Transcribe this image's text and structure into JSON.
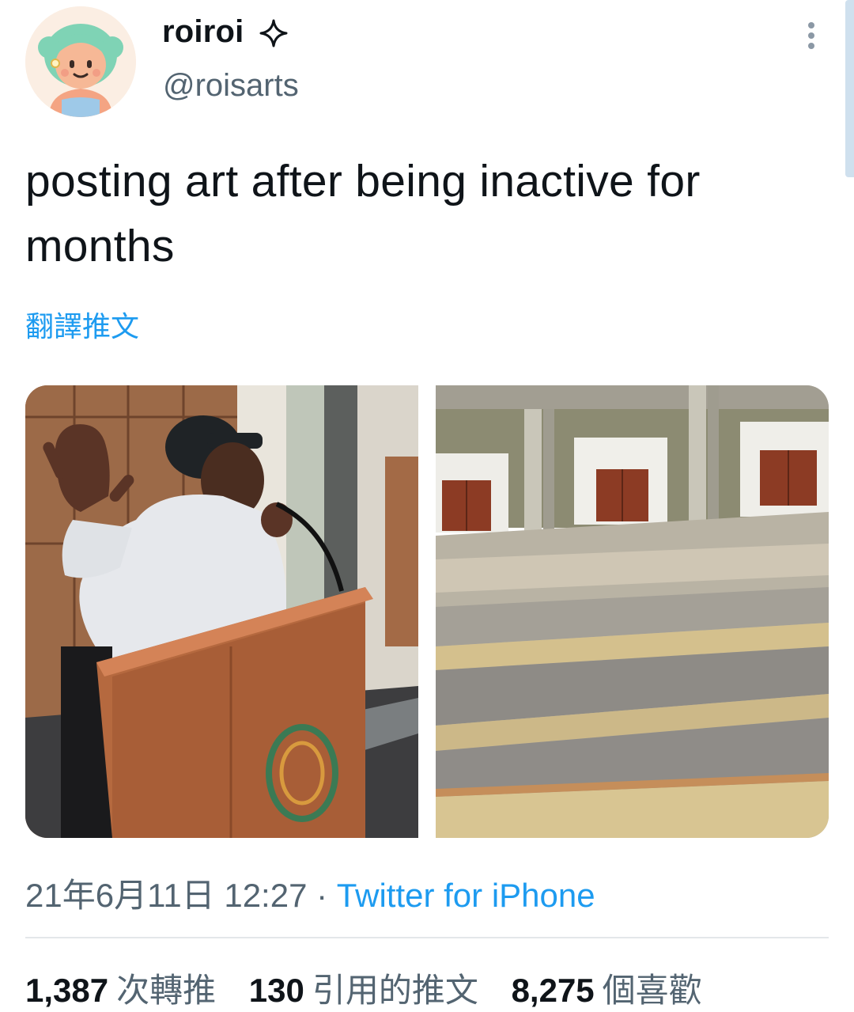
{
  "tweet": {
    "display_name": "roiroi",
    "handle": "@roisarts",
    "text": "posting art after being inactive for months",
    "translate_label": "翻譯推文",
    "timestamp": "21年6月11日 12:27",
    "separator": " · ",
    "source": "Twitter for iPhone"
  },
  "stats": [
    {
      "count": "1,387",
      "label": "次轉推"
    },
    {
      "count": "130",
      "label": "引用的推文"
    },
    {
      "count": "8,275",
      "label": "個喜歡"
    }
  ],
  "icons": {
    "badge": "sparkle-icon",
    "menu": "more-vertical-icon"
  },
  "colors": {
    "link": "#1d9bf0",
    "secondary_text": "#536471",
    "primary_text": "#0f1419"
  }
}
